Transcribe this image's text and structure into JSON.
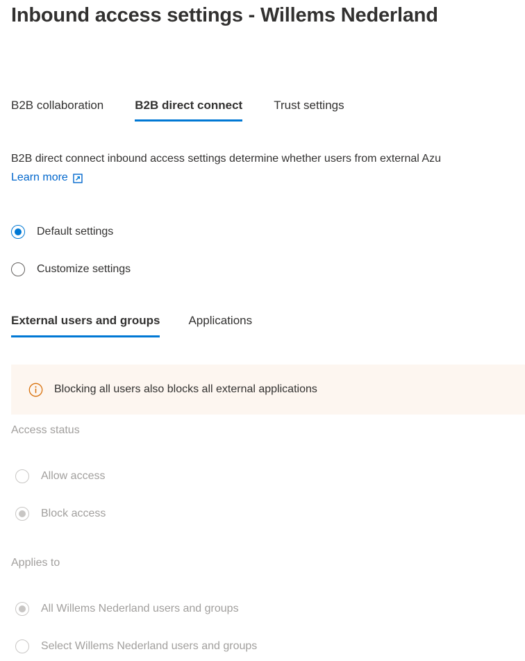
{
  "page": {
    "title": "Inbound access settings - Willems Nederland",
    "tenant_name": "Willems Nederland"
  },
  "pivots": {
    "items": [
      {
        "label": "B2B collaboration",
        "selected": false
      },
      {
        "label": "B2B direct connect",
        "selected": true
      },
      {
        "label": "Trust settings",
        "selected": false
      }
    ]
  },
  "description": {
    "text": "B2B direct connect inbound access settings determine whether users from external Azu",
    "learn_more_label": "Learn more",
    "learn_more_icon": "external-link-icon"
  },
  "settings_mode": {
    "options": [
      {
        "label": "Default settings",
        "checked": true,
        "disabled": false
      },
      {
        "label": "Customize settings",
        "checked": false,
        "disabled": false
      }
    ]
  },
  "subpivots": {
    "items": [
      {
        "label": "External users and groups",
        "selected": true
      },
      {
        "label": "Applications",
        "selected": false
      }
    ]
  },
  "banner": {
    "icon": "info-circle-icon",
    "message": "Blocking all users also blocks all external applications",
    "background_color": "#fdf6f0",
    "icon_color": "#d8700a"
  },
  "access_status": {
    "label": "Access status",
    "options": [
      {
        "label": "Allow access",
        "checked": false,
        "disabled": true
      },
      {
        "label": "Block access",
        "checked": true,
        "disabled": true
      }
    ]
  },
  "applies_to": {
    "label": "Applies to",
    "options": [
      {
        "label": "All Willems Nederland users and groups",
        "checked": true,
        "disabled": true
      },
      {
        "label": "Select Willems Nederland users and groups",
        "checked": false,
        "disabled": true
      }
    ]
  },
  "colors": {
    "accent": "#0078d4",
    "link": "#0066cc",
    "text": "#323130",
    "disabled_text": "#a19f9d",
    "banner_bg": "#fdf6f0",
    "banner_icon": "#d8700a"
  }
}
